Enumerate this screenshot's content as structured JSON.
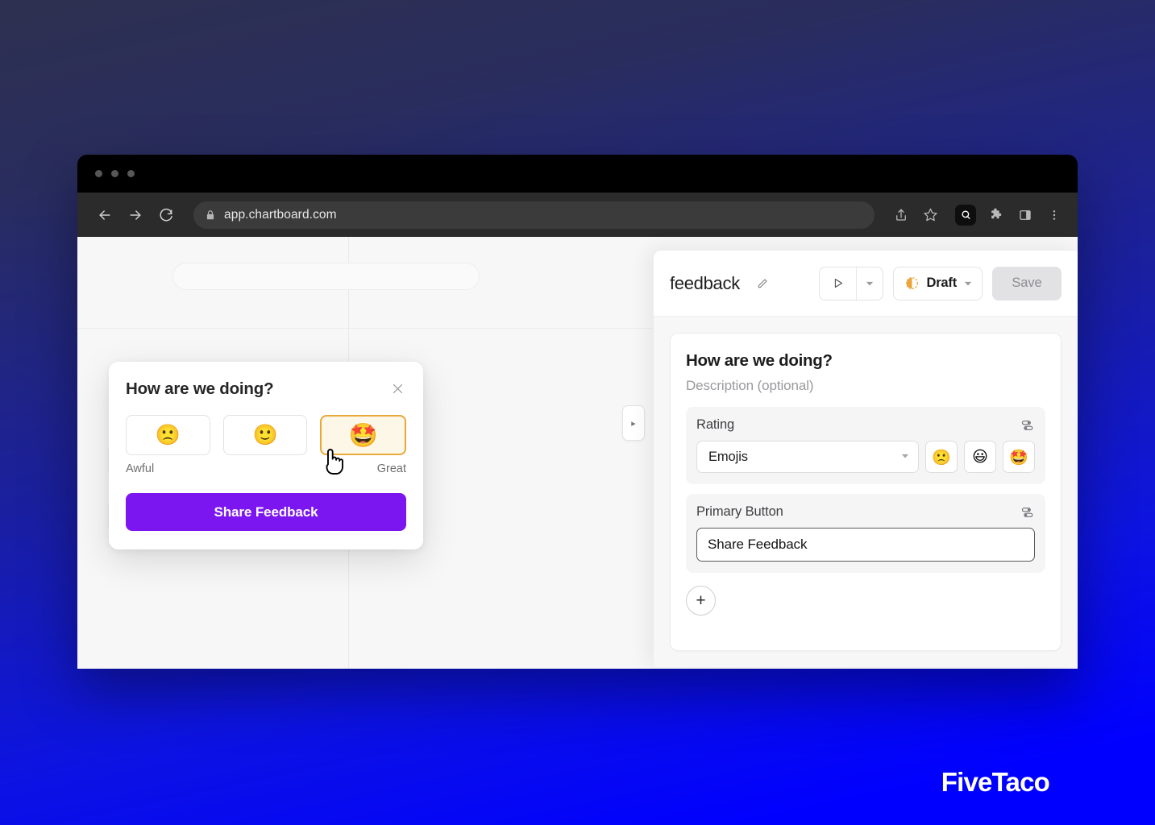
{
  "browser": {
    "url": "app.chartboard.com",
    "nav": {
      "back": "back-arrow",
      "forward": "forward-arrow",
      "reload": "reload-arrow",
      "lock": "lock-icon"
    },
    "toolbar_icons": [
      "share-icon",
      "bookmark-star-icon",
      "profile-icon",
      "extensions-puzzle-icon",
      "sidebar-panel-icon",
      "kebab-menu-icon"
    ]
  },
  "app": {
    "panel_toggle_label": "▸"
  },
  "feedback_modal": {
    "title": "How are we doing?",
    "close_label": "✕",
    "options": [
      {
        "emoji": "🙁",
        "name": "frowning-face",
        "selected": false
      },
      {
        "emoji": "🙂",
        "name": "slightly-smiling-face",
        "selected": false
      },
      {
        "emoji": "🤩",
        "name": "star-struck-face",
        "selected": true
      }
    ],
    "scale_low": "Awful",
    "scale_high": "Great",
    "submit_label": "Share Feedback",
    "accent_color": "#7c16f0",
    "selected_border_color": "#e9a93a",
    "selected_bg_color": "#fdf7e8"
  },
  "editor": {
    "name": "feedback",
    "edit_icon": "pencil-icon",
    "run_label": "▷",
    "run_caret": "▾",
    "status": {
      "label": "Draft",
      "icon": "half-circle-icon",
      "icon_color": "#eaa63c",
      "caret": "▾"
    },
    "save_label": "Save",
    "form": {
      "title": "How are we doing?",
      "description_placeholder": "Description (optional)",
      "fields": [
        {
          "label": "Rating",
          "type": "select",
          "value": "Emojis",
          "settings_icon": "sliders-icon",
          "swatches": [
            {
              "emoji": "🙁",
              "name": "frowning-face"
            },
            {
              "emoji": "😃",
              "name": "grinning-face"
            },
            {
              "emoji": "🤩",
              "name": "star-struck-face"
            }
          ]
        },
        {
          "label": "Primary Button",
          "type": "text",
          "value": "Share Feedback",
          "settings_icon": "sliders-icon"
        }
      ],
      "add_field_label": "+"
    }
  },
  "brand": {
    "name": "FiveTaco"
  }
}
